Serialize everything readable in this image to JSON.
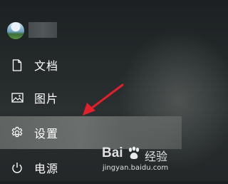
{
  "start_menu": {
    "user": {
      "name": ""
    },
    "items": [
      {
        "label": "文档",
        "icon": "document-icon"
      },
      {
        "label": "图片",
        "icon": "pictures-icon"
      },
      {
        "label": "设置",
        "icon": "gear-icon",
        "highlighted": true
      },
      {
        "label": "电源",
        "icon": "power-icon"
      }
    ]
  },
  "annotation": {
    "color": "#e0202a"
  },
  "watermark": {
    "logo_prefix": "Bai",
    "logo_suffix": "经验",
    "url": "jingyan.baidu.com"
  }
}
